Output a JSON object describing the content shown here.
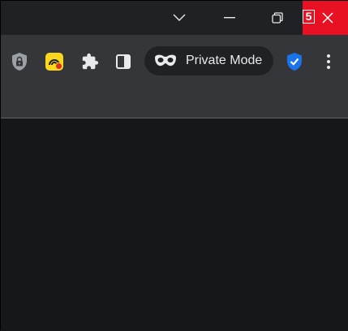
{
  "titlebar": {
    "icons": {
      "tab_search": "chevron-down-icon",
      "minimize": "minimize-icon",
      "restore": "restore-icon",
      "close": "close-icon"
    },
    "badge_number": "5",
    "close_color": "#e81123"
  },
  "toolbar": {
    "extensions": [
      {
        "icon": "lock-shield-icon"
      },
      {
        "icon": "yellow-extension-icon"
      },
      {
        "icon": "puzzle-icon"
      },
      {
        "icon": "side-panel-icon"
      }
    ],
    "private_mode_label": "Private Mode",
    "shield_icon": "blue-check-shield-icon",
    "menu_icon": "three-dots-menu-icon"
  },
  "colors": {
    "titlebar_bg": "#202124",
    "toolbar_bg": "#35363a",
    "content_bg": "#16171a",
    "accent_blue": "#1a73e8",
    "extension_yellow": "#f9d71c"
  }
}
